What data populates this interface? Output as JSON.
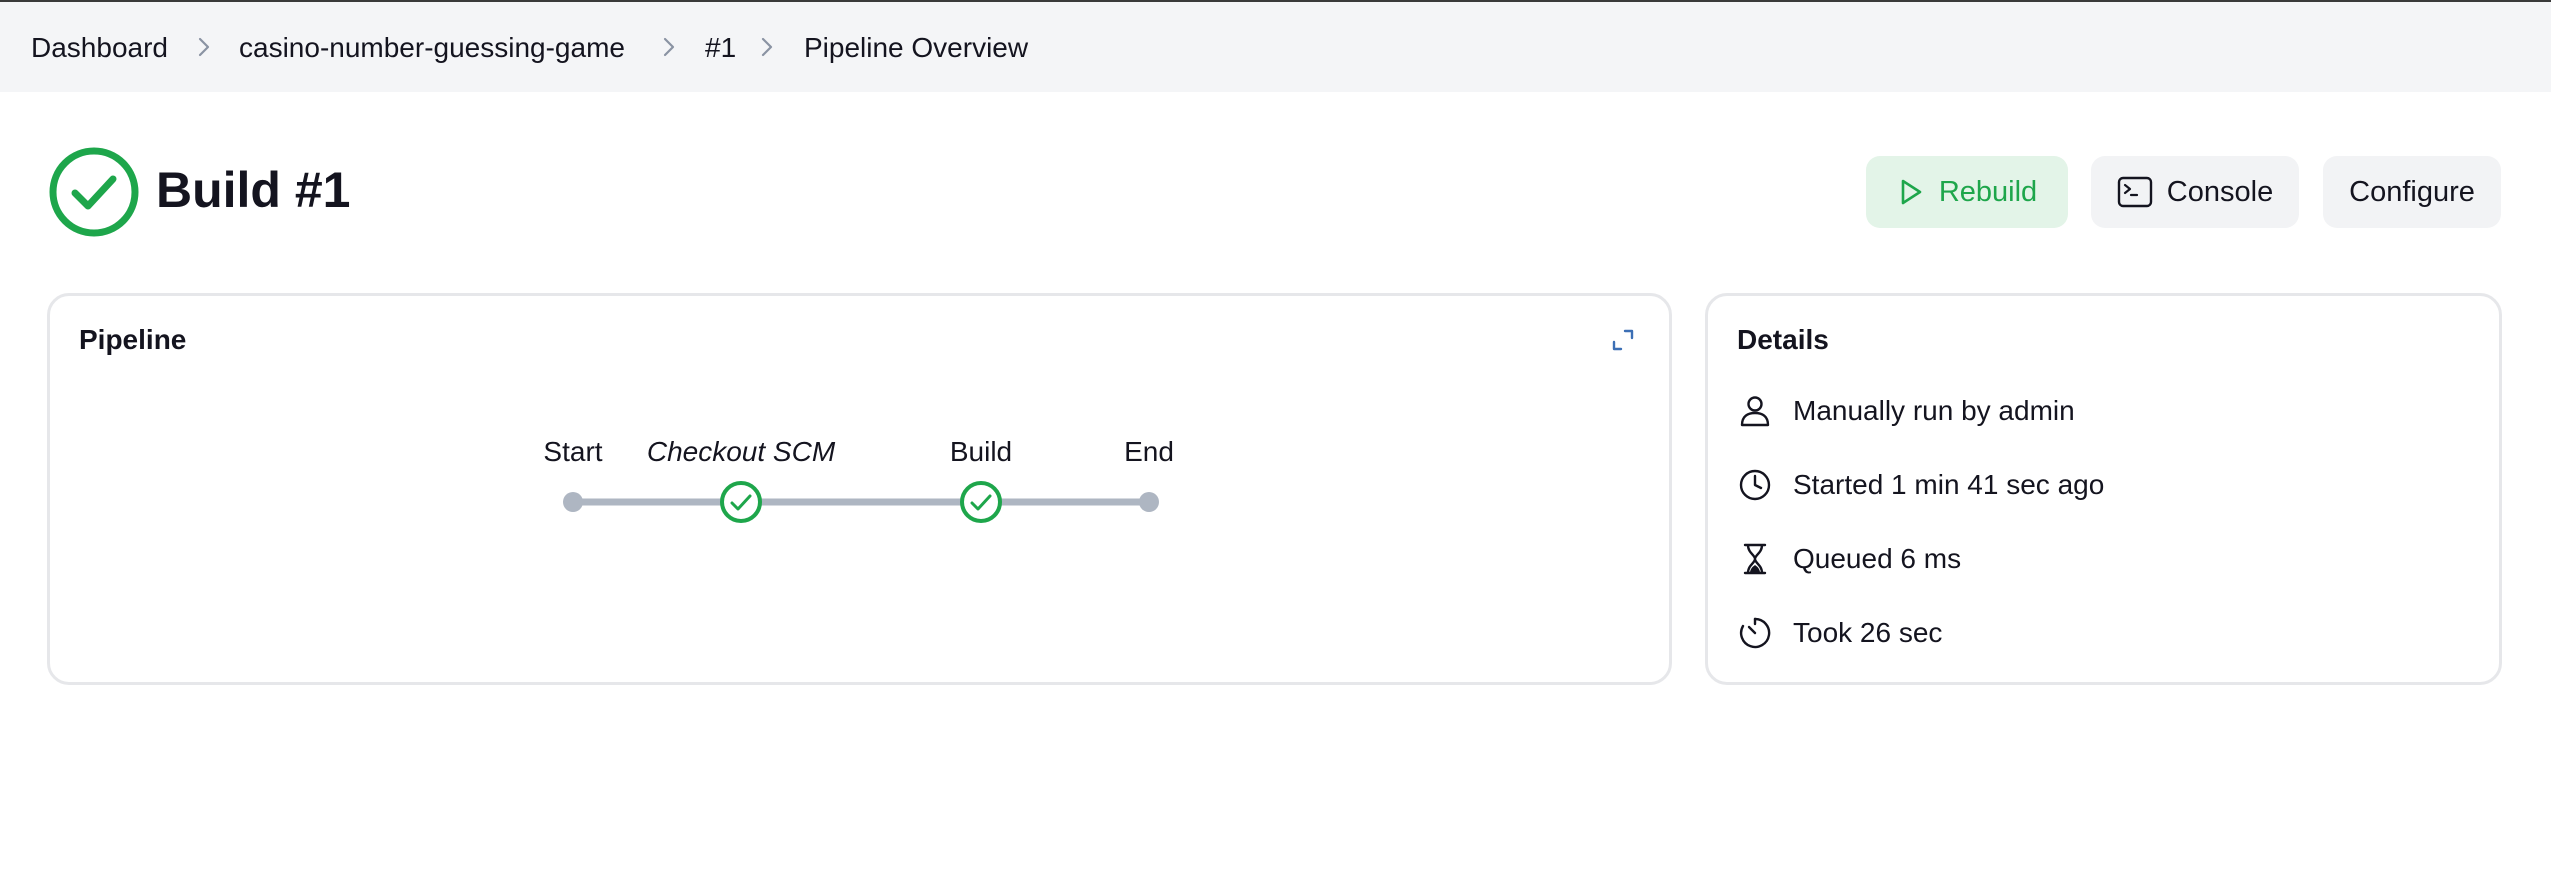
{
  "breadcrumb": {
    "items": [
      "Dashboard",
      "casino-number-guessing-game",
      "#1",
      "Pipeline Overview"
    ]
  },
  "header": {
    "status": "success",
    "status_icon": "check-circle-icon",
    "title": "Build #1"
  },
  "actions": {
    "rebuild_label": "Rebuild",
    "console_label": "Console",
    "configure_label": "Configure"
  },
  "pipeline": {
    "title": "Pipeline",
    "stages": [
      {
        "label": "Start",
        "type": "start",
        "italic": false
      },
      {
        "label": "Checkout SCM",
        "type": "stage",
        "status": "success",
        "italic": true
      },
      {
        "label": "Build",
        "type": "stage",
        "status": "success",
        "italic": false
      },
      {
        "label": "End",
        "type": "end",
        "italic": false
      }
    ]
  },
  "details": {
    "title": "Details",
    "rows": [
      {
        "icon": "user-icon",
        "text": "Manually run by admin"
      },
      {
        "icon": "clock-icon",
        "text": "Started 1 min 41 sec ago"
      },
      {
        "icon": "hourglass-icon",
        "text": "Queued 6 ms"
      },
      {
        "icon": "timer-icon",
        "text": "Took 26 sec"
      }
    ]
  },
  "colors": {
    "success": "#1ea64b",
    "rebuild_bg": "#e3f4e8",
    "node_gray": "#aeb6c2",
    "breadcrumb_bg": "#f4f5f7"
  }
}
